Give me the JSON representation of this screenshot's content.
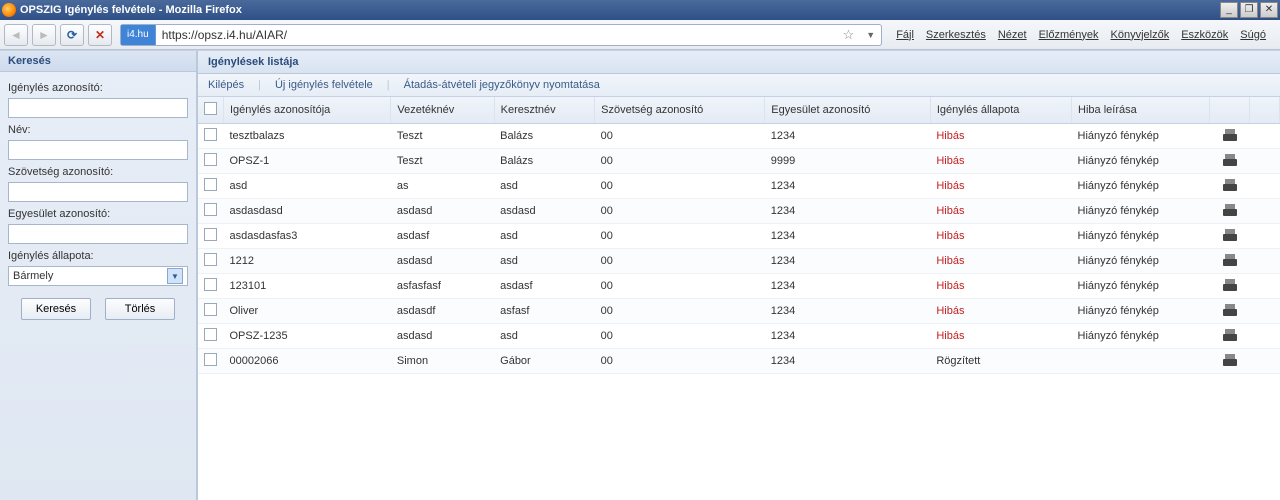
{
  "window": {
    "title": "OPSZIG Igénylés felvétele - Mozilla Firefox"
  },
  "browser": {
    "url_prefix": "i4.hu",
    "url": "https://opsz.i4.hu/AIAR/",
    "menus": [
      "Fájl",
      "Szerkesztés",
      "Nézet",
      "Előzmények",
      "Könyvjelzők",
      "Eszközök",
      "Súgó"
    ]
  },
  "sidebar": {
    "header": "Keresés",
    "labels": {
      "id": "Igénylés azonosító:",
      "name": "Név:",
      "federation": "Szövetség azonosító:",
      "club": "Egyesület azonosító:",
      "status": "Igénylés állapota:"
    },
    "status_value": "Bármely",
    "buttons": {
      "search": "Keresés",
      "clear": "Törlés"
    }
  },
  "content": {
    "header": "Igénylések listája",
    "actions": {
      "logout": "Kilépés",
      "new": "Új igénylés felvétele",
      "print": "Átadás-átvételi jegyzőkönyv nyomtatása"
    },
    "columns": {
      "id": "Igénylés azonosítója",
      "lastname": "Vezetéknév",
      "firstname": "Keresztnév",
      "federation": "Szövetség azonosító",
      "club": "Egyesület azonosító",
      "status": "Igénylés állapota",
      "error": "Hiba leírása"
    },
    "rows": [
      {
        "id": "tesztbalazs",
        "lastname": "Teszt",
        "firstname": "Balázs",
        "federation": "00",
        "club": "1234",
        "status": "Hibás",
        "status_flag": "error",
        "error": "Hiányzó fénykép"
      },
      {
        "id": "OPSZ-1",
        "lastname": "Teszt",
        "firstname": "Balázs",
        "federation": "00",
        "club": "9999",
        "status": "Hibás",
        "status_flag": "error",
        "error": "Hiányzó fénykép"
      },
      {
        "id": "asd",
        "lastname": "as",
        "firstname": "asd",
        "federation": "00",
        "club": "1234",
        "status": "Hibás",
        "status_flag": "error",
        "error": "Hiányzó fénykép"
      },
      {
        "id": "asdasdasd",
        "lastname": "asdasd",
        "firstname": "asdasd",
        "federation": "00",
        "club": "1234",
        "status": "Hibás",
        "status_flag": "error",
        "error": "Hiányzó fénykép"
      },
      {
        "id": "asdasdasfas3",
        "lastname": "asdasf",
        "firstname": "asd",
        "federation": "00",
        "club": "1234",
        "status": "Hibás",
        "status_flag": "error",
        "error": "Hiányzó fénykép"
      },
      {
        "id": "1212",
        "lastname": "asdasd",
        "firstname": "asd",
        "federation": "00",
        "club": "1234",
        "status": "Hibás",
        "status_flag": "error",
        "error": "Hiányzó fénykép"
      },
      {
        "id": "123101",
        "lastname": "asfasfasf",
        "firstname": "asdasf",
        "federation": "00",
        "club": "1234",
        "status": "Hibás",
        "status_flag": "error",
        "error": "Hiányzó fénykép"
      },
      {
        "id": "Oliver",
        "lastname": "asdasdf",
        "firstname": "asfasf",
        "federation": "00",
        "club": "1234",
        "status": "Hibás",
        "status_flag": "error",
        "error": "Hiányzó fénykép"
      },
      {
        "id": "OPSZ-1235",
        "lastname": "asdasd",
        "firstname": "asd",
        "federation": "00",
        "club": "1234",
        "status": "Hibás",
        "status_flag": "error",
        "error": "Hiányzó fénykép"
      },
      {
        "id": "00002066",
        "lastname": "Simon",
        "firstname": "Gábor",
        "federation": "00",
        "club": "1234",
        "status": "Rögzített",
        "status_flag": "ok",
        "error": ""
      }
    ]
  }
}
